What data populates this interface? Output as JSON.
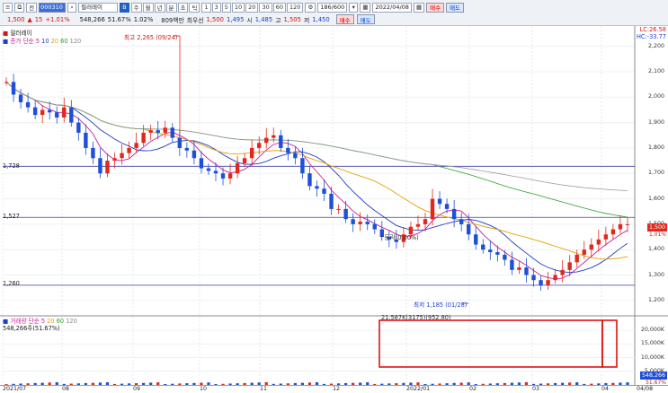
{
  "toolbar": {
    "row1": {
      "icons": [
        "menu-icon",
        "copy-icon"
      ],
      "period_label": "전",
      "code": "000310",
      "search_icon": "search-icon",
      "stock_name": "필러레이",
      "tag_b": "B",
      "periods": [
        "주",
        "월",
        "년",
        "분",
        "초",
        "틱"
      ],
      "intervals": [
        "1",
        "3",
        "5",
        "10",
        "20",
        "30",
        "60",
        "120"
      ],
      "count": "186",
      "count_total": "600",
      "date": "2022/04/08",
      "buy_label": "매수",
      "sell_label": "매도"
    },
    "row2": {
      "price": "1,500",
      "change_symbol": "▲",
      "change": "15",
      "change_rate": "+1.01%",
      "volume": "548,266",
      "vol_ratio": "51.67%",
      "turnover": "1.02%",
      "amount": "809백만",
      "best_ask_label": "최우선",
      "best_ask": "1,500",
      "best_bid": "1,495",
      "open_label": "시",
      "open": "1,485",
      "high_label": "고",
      "high": "1,505",
      "low_label": "저",
      "low": "1,450"
    }
  },
  "chart": {
    "name_label": "필러레이",
    "ma_label": "종가 단순",
    "ma_periods": [
      "5",
      "10",
      "20",
      "60",
      "120"
    ],
    "ma_colors": [
      "#c81e9a",
      "#1e3cc8",
      "#e6a000",
      "#2ca02c",
      "#999999"
    ],
    "lc": "LC:26.58",
    "hc": "HC:-33.77",
    "high_annot": "최고 2,265 (09/24)",
    "low_annot": "최저 1,185 (01/28)",
    "event_annot": "↑동락(0.00%)",
    "hline_labels": [
      "1,728",
      "1,527",
      "1,260"
    ],
    "yticks": [
      "2,200",
      "2,100",
      "2,000",
      "1,900",
      "1,800",
      "1,700",
      "1,600",
      "1,500",
      "1,400",
      "1,300",
      "1,200"
    ],
    "current_price": "1,500",
    "current_change": "1.01%",
    "up_color": "#e0281e",
    "down_color": "#1e4fd8"
  },
  "volume": {
    "title": "거래량 단순",
    "ma_periods": [
      "5",
      "20",
      "60",
      "120"
    ],
    "current": "548,266주(51.67%)",
    "box_annot": "21,587K(3175)(952.80)",
    "yticks": [
      "20,000K",
      "15,000K",
      "10,000K",
      "5,000K"
    ],
    "current_value": "548,266",
    "current_pct": "51.67%"
  },
  "xaxis": {
    "labels": [
      "2021/07",
      "08",
      "09",
      "10",
      "11",
      "12",
      "2022/01",
      "02",
      "03",
      "04",
      "04/08"
    ]
  },
  "chart_data": {
    "type": "candlestick",
    "title": "필러레이",
    "ylabel": "",
    "ylim": [
      1150,
      2280
    ],
    "series": [
      {
        "name": "price",
        "values": [
          2060,
          2010,
          1980,
          1960,
          1930,
          1950,
          1940,
          1920,
          1960,
          1900,
          1860,
          1800,
          1760,
          1700,
          1750,
          1760,
          1780,
          1800,
          1820,
          1860,
          1870,
          1860,
          1880,
          1840,
          1800,
          1790,
          1760,
          1720,
          1710,
          1700,
          1680,
          1700,
          1740,
          1760,
          1800,
          1820,
          1840,
          1850,
          1800,
          1780,
          1760,
          1700,
          1650,
          1640,
          1620,
          1560,
          1560,
          1520,
          1500,
          1510,
          1500,
          1480,
          1450,
          1440,
          1430,
          1460,
          1490,
          1500,
          1520,
          1600,
          1580,
          1560,
          1520,
          1500,
          1460,
          1420,
          1400,
          1390,
          1380,
          1360,
          1320,
          1330,
          1300,
          1280,
          1260,
          1280,
          1300,
          1320,
          1350,
          1380,
          1400,
          1420,
          1440,
          1460,
          1480,
          1500,
          1500
        ]
      }
    ]
  }
}
